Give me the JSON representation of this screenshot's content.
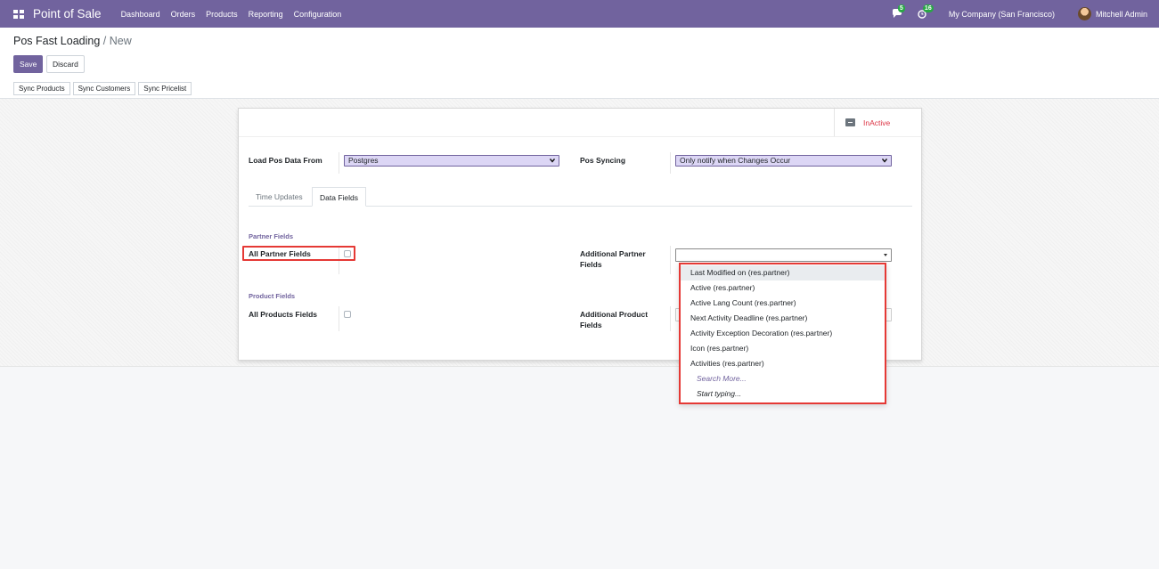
{
  "navbar": {
    "app_name": "Point of Sale",
    "menu": [
      "Dashboard",
      "Orders",
      "Products",
      "Reporting",
      "Configuration"
    ],
    "messages_count": "5",
    "activities_count": "16",
    "company": "My Company (San Francisco)",
    "user": "Mitchell Admin",
    "icons": [
      "apps-icon",
      "chat-icon",
      "clock-icon",
      "avatar"
    ]
  },
  "breadcrumb": {
    "parent": "Pos Fast Loading",
    "separator": "/",
    "current": "New"
  },
  "actions": {
    "save": "Save",
    "discard": "Discard"
  },
  "sync_buttons": [
    "Sync Products",
    "Sync Customers",
    "Sync Pricelist"
  ],
  "sheet": {
    "status_button": "InActive",
    "load_from_label": "Load Pos Data From",
    "load_from_value": "Postgres",
    "syncing_label": "Pos Syncing",
    "syncing_value": "Only notify when Changes Occur",
    "tabs": [
      "Time Updates",
      "Data Fields"
    ],
    "active_tab": "Data Fields",
    "partner_group": "Partner Fields",
    "all_partner_label": "All Partner Fields",
    "additional_partner_label_1": "Additional Partner",
    "additional_partner_label_2": "Fields",
    "product_group": "Product Fields",
    "all_products_label": "All Products Fields",
    "additional_product_label_1": "Additional Product",
    "additional_product_label_2": "Fields"
  },
  "dropdown": {
    "items": [
      "Last Modified on (res.partner)",
      "Active (res.partner)",
      "Active Lang Count (res.partner)",
      "Next Activity Deadline (res.partner)",
      "Activity Exception Decoration (res.partner)",
      "Icon (res.partner)",
      "Activities (res.partner)"
    ],
    "search_more": "Search More...",
    "start_typing": "Start typing..."
  },
  "colors": {
    "brand": "#71639e",
    "danger": "#e53935",
    "select_bg": "#dcd6f5"
  }
}
